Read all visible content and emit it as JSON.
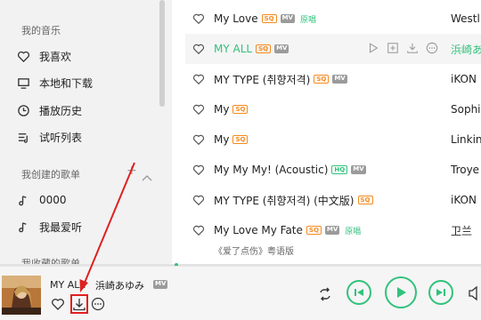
{
  "sidebar": {
    "section_music": "我的音乐",
    "items_music": [
      {
        "label": "我喜欢",
        "icon": "heart-icon"
      },
      {
        "label": "本地和下载",
        "icon": "monitor-icon"
      },
      {
        "label": "播放历史",
        "icon": "clock-icon"
      },
      {
        "label": "试听列表",
        "icon": "playlist-icon"
      }
    ],
    "section_created": "我创建的歌单",
    "items_created": [
      {
        "label": "0000",
        "icon": "music-note-icon"
      },
      {
        "label": "我最爱听",
        "icon": "music-note-icon"
      }
    ],
    "section_collected": "我收藏的歌单"
  },
  "songs": [
    {
      "title": "My Love",
      "badges": [
        "SQ",
        "MV"
      ],
      "original": "原唱",
      "artist": "Westlife"
    },
    {
      "title": "MY ALL",
      "badges": [
        "SQ",
        "MV"
      ],
      "original": "",
      "artist": "浜崎あゆみ",
      "active": true
    },
    {
      "title": "MY TYPE (취향저격)",
      "badges": [
        "SQ",
        "MV"
      ],
      "original": "",
      "artist": "iKON"
    },
    {
      "title": "My",
      "badges": [
        "SQ"
      ],
      "original": "",
      "artist": "Sophie"
    },
    {
      "title": "My",
      "badges": [
        "SQ"
      ],
      "original": "",
      "artist": "Linkin"
    },
    {
      "title": "My My My! (Acoustic)",
      "badges": [
        "HQ",
        "MV"
      ],
      "original": "",
      "artist": "Troye"
    },
    {
      "title": "MY TYPE (취향저격) (中文版)",
      "badges": [
        "SQ"
      ],
      "original": "",
      "artist": "iKON"
    },
    {
      "title": "My Love My Fate",
      "badges": [
        "SQ",
        "MV"
      ],
      "original": "原唱",
      "artist": "卫兰"
    }
  ],
  "song_subline": "《爱了点伤》粤语版",
  "player": {
    "title": "MY ALL",
    "artist": "浜崎あゆみ",
    "mv_badge": "MV",
    "progress": 0
  },
  "colors": {
    "accent": "#31c27c",
    "sq": "#f58a1f",
    "annotation": "#e02020"
  }
}
